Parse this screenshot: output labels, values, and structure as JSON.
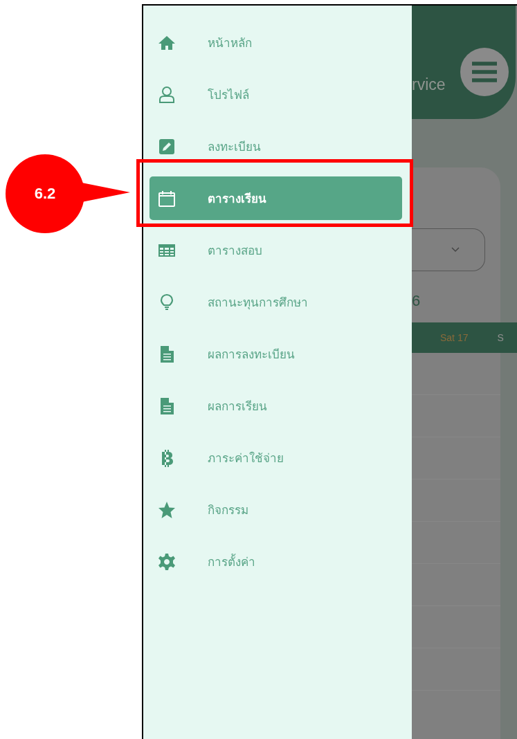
{
  "annotation": {
    "label": "6.2"
  },
  "drawer": {
    "items": [
      {
        "kind": "home",
        "label": "หน้าหลัก",
        "selected": false
      },
      {
        "kind": "user",
        "label": "โปรไฟล์",
        "selected": false
      },
      {
        "kind": "edit",
        "label": "ลงทะเบียน",
        "selected": false
      },
      {
        "kind": "calendar",
        "label": "ตารางเรียน",
        "selected": true
      },
      {
        "kind": "table",
        "label": "ตารางสอบ",
        "selected": false
      },
      {
        "kind": "bulb",
        "label": "สถานะทุนการศึกษา",
        "selected": false
      },
      {
        "kind": "document",
        "label": "ผลการลงทะเบียน",
        "selected": false
      },
      {
        "kind": "document",
        "label": "ผลการเรียน",
        "selected": false
      },
      {
        "kind": "baht",
        "label": "ภาระค่าใช้จ่าย",
        "selected": false
      },
      {
        "kind": "star",
        "label": "กิจกรรม",
        "selected": false
      },
      {
        "kind": "gear",
        "label": "การตั้งค่า",
        "selected": false
      }
    ]
  },
  "background_app": {
    "header_title": "rvice",
    "year": "6",
    "day_columns": [
      "Sat 17",
      "S"
    ]
  }
}
